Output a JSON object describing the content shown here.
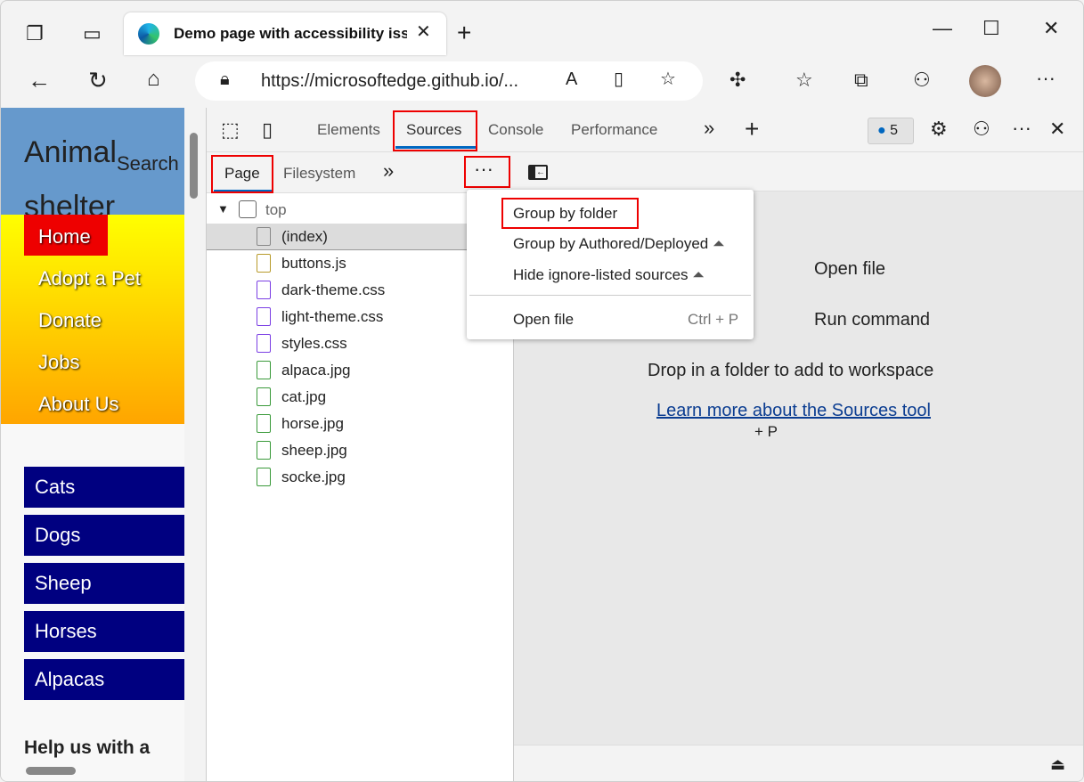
{
  "browser": {
    "tab_title": "Demo page with accessibility issues",
    "url": "https://microsoftedge.github.io/..."
  },
  "webpage": {
    "title_line1": "Animal",
    "title_line2": "shelter",
    "search": "Search",
    "nav": [
      "Home",
      "Adopt a Pet",
      "Donate",
      "Jobs",
      "About Us"
    ],
    "categories": [
      "Cats",
      "Dogs",
      "Sheep",
      "Horses",
      "Alpacas"
    ],
    "help": "Help us with a"
  },
  "devtools": {
    "tabs": [
      "Elements",
      "Sources",
      "Console",
      "Performance"
    ],
    "active_tab": "Sources",
    "issues_count": "5",
    "subtabs": [
      "Page",
      "Filesystem"
    ],
    "active_subtab": "Page",
    "tree": {
      "root": "top",
      "files": [
        {
          "name": "(index)",
          "type": "document",
          "color": "#888888"
        },
        {
          "name": "buttons.js",
          "type": "script",
          "color": "#b89b2b"
        },
        {
          "name": "dark-theme.css",
          "type": "stylesheet",
          "color": "#7b3fe4"
        },
        {
          "name": "light-theme.css",
          "type": "stylesheet",
          "color": "#7b3fe4"
        },
        {
          "name": "styles.css",
          "type": "stylesheet",
          "color": "#7b3fe4"
        },
        {
          "name": "alpaca.jpg",
          "type": "image",
          "color": "#3a9a3a"
        },
        {
          "name": "cat.jpg",
          "type": "image",
          "color": "#3a9a3a"
        },
        {
          "name": "horse.jpg",
          "type": "image",
          "color": "#3a9a3a"
        },
        {
          "name": "sheep.jpg",
          "type": "image",
          "color": "#3a9a3a"
        },
        {
          "name": "socke.jpg",
          "type": "image",
          "color": "#3a9a3a"
        }
      ]
    },
    "menu": {
      "items": [
        "Group by folder",
        "Group by Authored/Deployed",
        "Hide ignore-listed sources"
      ],
      "open_file": "Open file",
      "open_file_shortcut": "Ctrl + P"
    },
    "editor": {
      "partial_shortcut": "+ P",
      "open_file": "Open file",
      "run_command": "Run command",
      "drop": "Drop in a folder to add to workspace",
      "learn_more": "Learn more about the Sources tool"
    }
  },
  "colors": {
    "highlight": "#e00000",
    "accent": "#0067c0",
    "nav_button": "#000080",
    "header": "#6699cc"
  }
}
